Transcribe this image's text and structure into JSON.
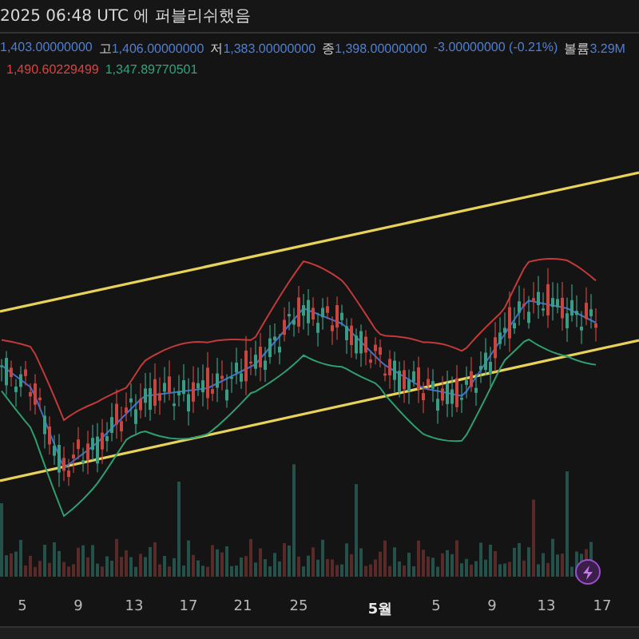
{
  "header": {
    "title": "2025 06:48 UTC 에 퍼블리쉬했음"
  },
  "ohlc": [
    {
      "value": "1,403.00000000"
    },
    {
      "label": "고",
      "value": "1,406.00000000"
    },
    {
      "label": "저",
      "value": "1,383.00000000"
    },
    {
      "label": "종",
      "value": "1,398.00000000"
    },
    {
      "value": "-3.00000000 (-0.21%)"
    },
    {
      "label": "볼륨",
      "value": "3.29M"
    }
  ],
  "bands": [
    {
      "value": "1,490.60229499",
      "color": "#e0413f"
    },
    {
      "value": "1,347.89770501",
      "color": "#2fa57c"
    }
  ],
  "x_axis": [
    "5",
    "9",
    "13",
    "17",
    "21",
    "25",
    "5월",
    "5",
    "9",
    "13",
    "17"
  ]
}
